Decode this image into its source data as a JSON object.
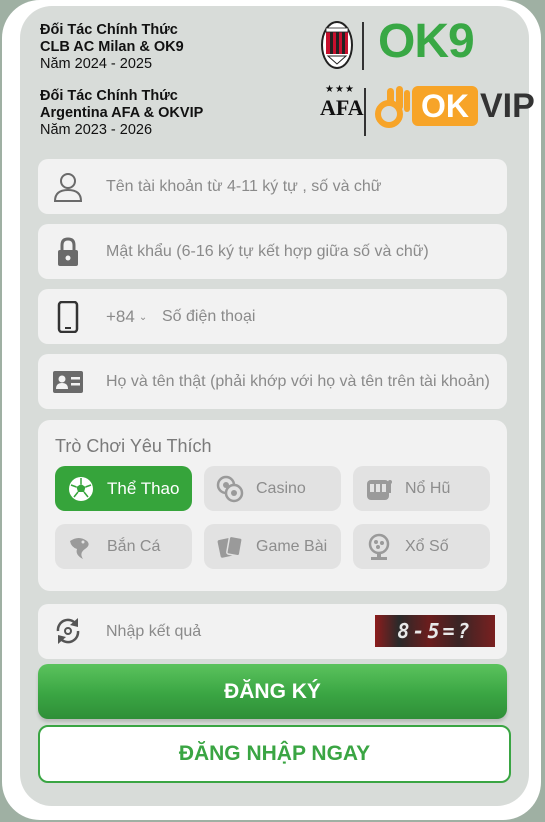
{
  "partners": [
    {
      "title_line1": "Đối Tác Chính Thức",
      "title_line2": "CLB AC Milan & OK9",
      "years": "Năm 2024 - 2025",
      "logo_text": "OK9"
    },
    {
      "title_line1": "Đối Tác Chính Thức",
      "title_line2": "Argentina AFA & OKVIP",
      "years": "Năm 2023 - 2026",
      "crest_text": "AFA",
      "logo_ok": "OK",
      "logo_vip": "VIP"
    }
  ],
  "form": {
    "username_placeholder": "Tên tài khoản từ 4-11 ký tự , số và chữ",
    "password_placeholder": "Mật khẩu (6-16 ký tự kết hợp giữa số và chữ)",
    "dial_code": "+84",
    "phone_placeholder": "Số điện thoại",
    "realname_placeholder": "Họ và tên thật (phải khớp với họ và tên trên tài khoản)"
  },
  "games": {
    "title": "Trò Chơi Yêu Thích",
    "options": [
      {
        "label": "Thể Thao",
        "icon": "soccer-ball-icon",
        "active": true
      },
      {
        "label": "Casino",
        "icon": "chips-icon",
        "active": false
      },
      {
        "label": "Nổ Hũ",
        "icon": "slot-machine-icon",
        "active": false
      },
      {
        "label": "Bắn Cá",
        "icon": "fish-icon",
        "active": false
      },
      {
        "label": "Game Bài",
        "icon": "cards-icon",
        "active": false
      },
      {
        "label": "Xổ Số",
        "icon": "lottery-icon",
        "active": false
      }
    ]
  },
  "captcha": {
    "placeholder": "Nhập kết quả",
    "image_text": "8-5=?"
  },
  "buttons": {
    "register": "ĐĂNG KÝ",
    "login": "ĐĂNG NHẬP NGAY"
  },
  "colors": {
    "primary": "#3aa543",
    "accent_orange": "#f7a428",
    "panel_bg": "#d8dcd9",
    "field_bg": "#f2f2f2"
  }
}
